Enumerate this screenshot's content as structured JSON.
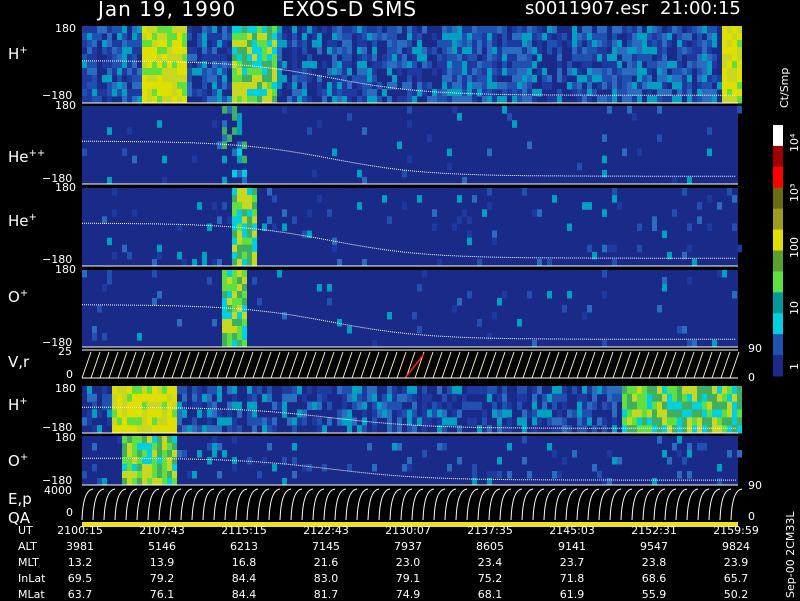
{
  "header": {
    "date": "Jan 19, 1990",
    "instrument": "EXOS-D SMS",
    "file": "s0011907.esr",
    "time": "21:00:15"
  },
  "panels": [
    {
      "label_main": "H",
      "label_sup": "+",
      "tick_top": "180",
      "tick_bottom": "−180"
    },
    {
      "label_main": "He",
      "label_sup": "++",
      "tick_top": "180",
      "tick_bottom": "−180"
    },
    {
      "label_main": "He",
      "label_sup": "+",
      "tick_top": "180",
      "tick_bottom": "−180"
    },
    {
      "label_main": "O",
      "label_sup": "+",
      "tick_top": "180",
      "tick_bottom": "−180"
    },
    {
      "label_main": "V,r",
      "label_sup": "",
      "tick_top": "25",
      "tick_bottom": "0",
      "right_top": "90",
      "right_bottom": "0"
    },
    {
      "label_main": "H",
      "label_sup": "+",
      "tick_top": "180",
      "tick_bottom": "−180"
    },
    {
      "label_main": "O",
      "label_sup": "+",
      "tick_top": "180",
      "tick_bottom": "−180"
    },
    {
      "label_main": "E,p",
      "label_sup": "",
      "label_line2": "QA",
      "tick_top": "4000",
      "tick_bottom": "0",
      "right_top": "90",
      "right_bottom": "0"
    }
  ],
  "colorbar": {
    "title": "Ct/Smp",
    "labels": [
      "10⁴",
      "10³",
      "100",
      "10",
      "1"
    ],
    "colors": [
      "#ffffff",
      "#a00000",
      "#ff0000",
      "#6b6b10",
      "#9c9c1e",
      "#e0e000",
      "#5aa030",
      "#60e040",
      "#009a9a",
      "#00d0e0",
      "#2050b0",
      "#1a2a88"
    ]
  },
  "footer": {
    "row_labels": [
      "UT",
      "ALT",
      "MLT",
      "InLat",
      "MLat"
    ],
    "columns": [
      [
        "2100:15",
        "3981",
        "13.2",
        "69.5",
        "63.7"
      ],
      [
        "2107:43",
        "5146",
        "13.9",
        "79.2",
        "76.1"
      ],
      [
        "2115:15",
        "6213",
        "16.8",
        "84.4",
        "84.4"
      ],
      [
        "2122:43",
        "7145",
        "21.6",
        "83.0",
        "81.7"
      ],
      [
        "2130:07",
        "7937",
        "23.0",
        "79.1",
        "74.9"
      ],
      [
        "2137:35",
        "8605",
        "23.4",
        "75.2",
        "68.1"
      ],
      [
        "2145:03",
        "9141",
        "23.7",
        "71.8",
        "61.9"
      ],
      [
        "2152:31",
        "9547",
        "23.8",
        "68.6",
        "55.9"
      ],
      [
        "2159:59",
        "9824",
        "23.9",
        "65.7",
        "50.2"
      ]
    ],
    "side_note": "Sep-00 2CM33L"
  },
  "chart_data": {
    "type": "heatmap",
    "title": "Jan 19, 1990   EXOS-D SMS",
    "x_tick_labels": [
      "2100:15",
      "2107:43",
      "2115:15",
      "2122:43",
      "2130:07",
      "2137:35",
      "2145:03",
      "2152:31",
      "2159:59"
    ],
    "panels": [
      "H+",
      "He++",
      "He+",
      "O+",
      "V,r",
      "H+",
      "O+",
      "E,p / QA"
    ],
    "pitch_angle_range": [
      -180,
      180
    ],
    "vr_range": [
      0,
      25
    ],
    "ep_range": [
      0,
      4000
    ],
    "right_axis_range": [
      0,
      90
    ],
    "colorbar_range_log": [
      1,
      10000
    ],
    "colorbar_unit": "Ct/Smp"
  }
}
